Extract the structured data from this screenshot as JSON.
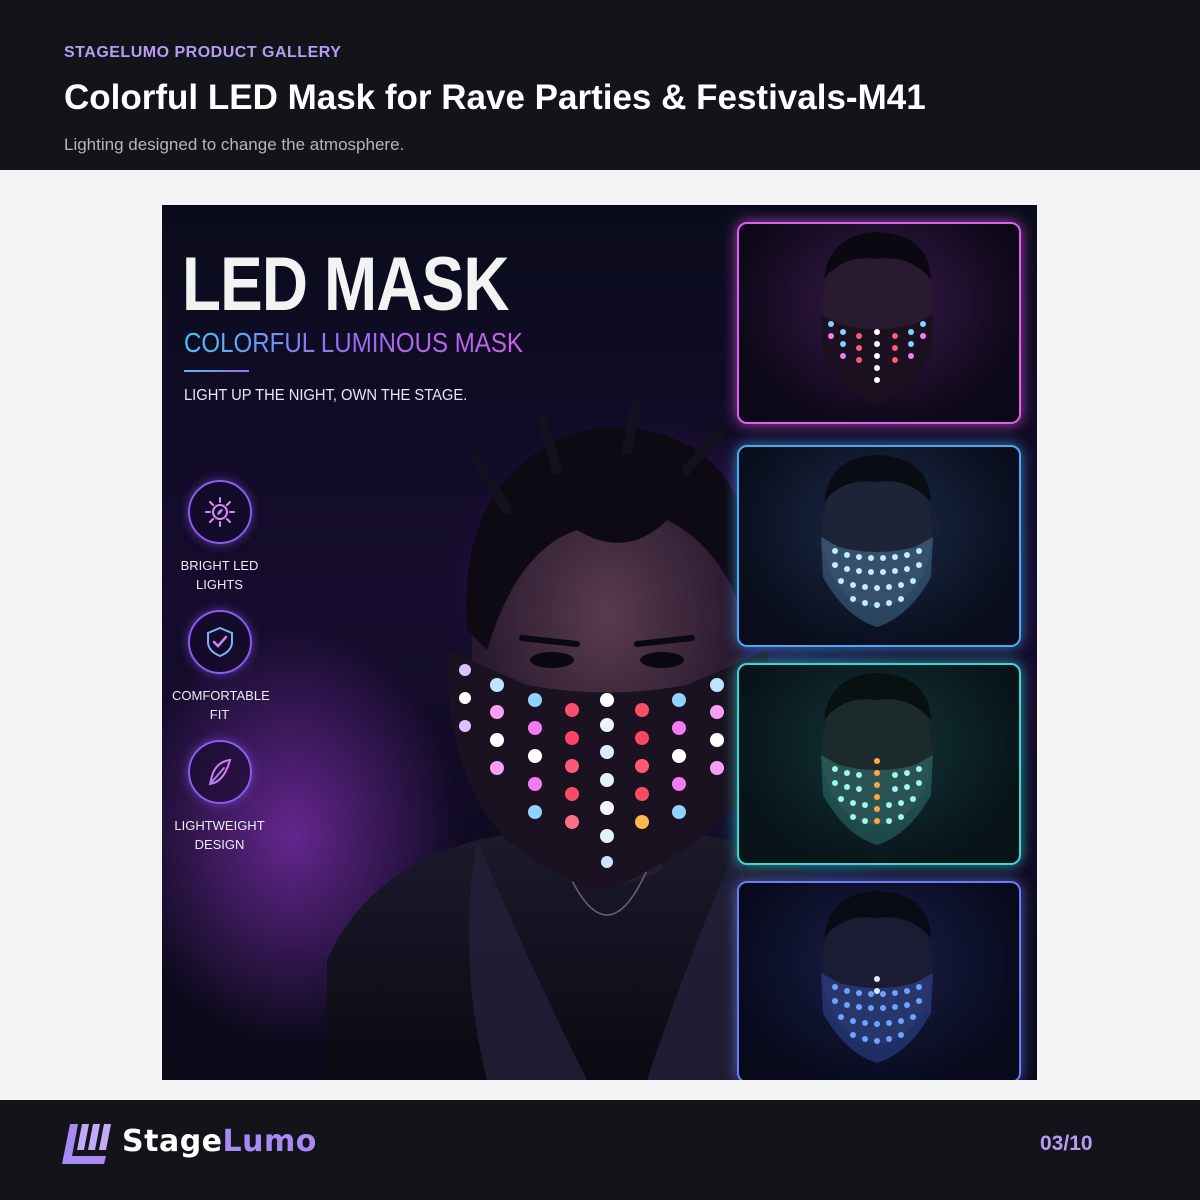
{
  "header": {
    "eyebrow": "STAGELUMO PRODUCT GALLERY",
    "title": "Colorful LED Mask for Rave Parties & Festivals-M41",
    "subtitle": "Lighting designed to change the atmosphere."
  },
  "poster": {
    "heading": "LED MASK",
    "subheading": "COLORFUL LUMINOUS MASK",
    "tagline": "LIGHT UP THE NIGHT, OWN THE STAGE.",
    "features": [
      {
        "label": "BRIGHT LED\nLIGHTS",
        "icon": "sun-leaf-icon"
      },
      {
        "label": "COMFORTABLE\nFIT",
        "icon": "shield-check-icon"
      },
      {
        "label": "LIGHTWEIGHT\nDESIGN",
        "icon": "feather-icon"
      }
    ],
    "thumbnails": [
      {
        "color_mode": "multicolor",
        "border": "#e35bf0"
      },
      {
        "color_mode": "ice-blue",
        "border": "#4aa8f5"
      },
      {
        "color_mode": "cyan-orange",
        "border": "#3fd6d8"
      },
      {
        "color_mode": "blue",
        "border": "#6b7cf5"
      }
    ]
  },
  "footer": {
    "brand_part1": "Stage",
    "brand_part2": "Lumo",
    "pager": "03/10"
  },
  "colors": {
    "header_bg": "#13131a",
    "accent_purple": "#b79cf4",
    "gallery_bg": "#f4f4f5"
  }
}
